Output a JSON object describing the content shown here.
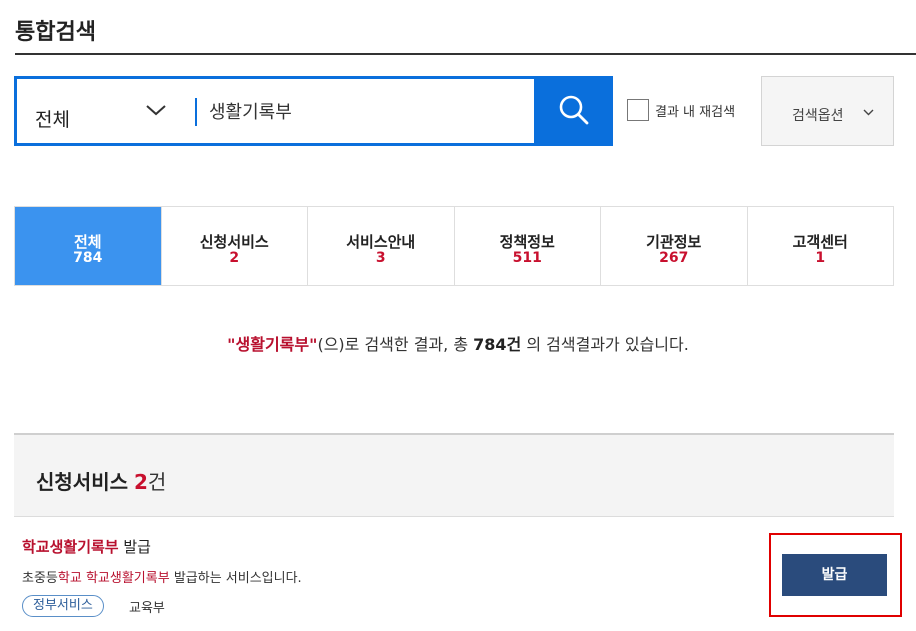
{
  "page": {
    "title": "통합검색"
  },
  "search": {
    "scope": "전체",
    "query": "생활기록부",
    "recheck_label": "결과 내 재검색",
    "options_label": "검색옵션"
  },
  "tabs": [
    {
      "label": "전체",
      "count": "784",
      "active": true
    },
    {
      "label": "신청서비스",
      "count": "2",
      "active": false
    },
    {
      "label": "서비스안내",
      "count": "3",
      "active": false
    },
    {
      "label": "정책정보",
      "count": "511",
      "active": false
    },
    {
      "label": "기관정보",
      "count": "267",
      "active": false
    },
    {
      "label": "고객센터",
      "count": "1",
      "active": false
    }
  ],
  "summary": {
    "keyword": "\"생활기록부\"",
    "mid": "(으)로 검색한 결과, 총 ",
    "total": "784건",
    "end": " 의 검색결과가 있습니다."
  },
  "section": {
    "title": "신청서비스",
    "count": "2",
    "unit": "건"
  },
  "results": [
    {
      "title_highlight": "학교생활기록부",
      "title_rest": " 발급",
      "desc_pre": "초중등",
      "desc_hl1": "학교",
      "desc_space": " ",
      "desc_hl2": "학교생활기록부",
      "desc_post": " 발급하는 서비스입니다.",
      "tag": "정부서비스",
      "org": "교육부",
      "action_label": "발급"
    }
  ],
  "colors": {
    "accent_blue": "#0a6fdc",
    "active_tab": "#3b93ef",
    "highlight_red": "#c8102e",
    "button_navy": "#2a4b7c",
    "annotation_red": "#e00000"
  }
}
